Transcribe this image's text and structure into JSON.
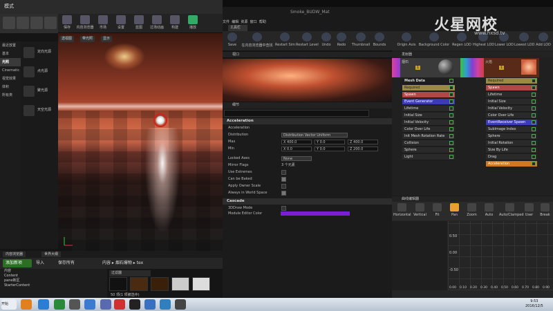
{
  "left_window": {
    "title": "模式",
    "toolbar": [
      "保存",
      "内容浏览器",
      "市场",
      "设置",
      "蓝图",
      "过场动画",
      "构建",
      "播放"
    ],
    "place_categories": [
      "最近放置",
      "基本",
      "光照",
      "Cinematic",
      "视觉效果",
      "体积",
      "所有类"
    ],
    "place_items": [
      "定向光源",
      "点光源",
      "聚光源",
      "天空光源"
    ],
    "viewport_buttons": [
      "透视图",
      "带光照",
      "显示"
    ]
  },
  "content_browser": {
    "tabs": [
      "内容浏览器",
      "世界大纲"
    ],
    "add_new": "添加新项",
    "import": "导入",
    "save_all": "保存所有",
    "breadcrumb": [
      "内容",
      "烟石爆物",
      "tex"
    ],
    "tree": [
      "内容",
      "Content",
      "pane新区",
      "StarterContent"
    ],
    "filters": "过滤器",
    "count": "50 项(1 项被选中)"
  },
  "cascade": {
    "window_title": "Smoke_BUDW_Mat",
    "tab": "工具栏",
    "menu": [
      "文件",
      "编辑",
      "资源",
      "窗口",
      "帮助"
    ],
    "toolbar": [
      "Save",
      "在内容浏览器中查找",
      "Restart Sim",
      "Restart Level",
      "Undo",
      "Redo",
      "Thumbnail",
      "Bounds",
      "Origin Axis",
      "Background Color",
      "Regen LOD",
      "Highest LOD",
      "Lower LOD",
      "Lowest LOD",
      "Add LOD"
    ],
    "preview_title": "视口",
    "details_title": "细节",
    "emitters_title": "发射器",
    "curve_title": "曲线编辑器"
  },
  "details": {
    "section1": "Acceleration",
    "rows": [
      {
        "label": "Acceleration",
        "value": ""
      },
      {
        "label": "Distribution",
        "value": "Distribution Vector Uniform"
      },
      {
        "label": "Max",
        "x": "400.0",
        "y": "0.0",
        "z": "400.0"
      },
      {
        "label": "Min",
        "x": "0.0",
        "y": "0.0",
        "z": "200.0"
      },
      {
        "label": "Locked Axes",
        "value": "None"
      },
      {
        "label": "Mirror Flags",
        "value": "3 个元素"
      },
      {
        "label": "Use Extremes",
        "value": ""
      },
      {
        "label": "Can be Baked",
        "value": ""
      },
      {
        "label": "Apply Owner Scale",
        "value": ""
      },
      {
        "label": "Always in World Space",
        "value": ""
      }
    ],
    "section2": "Cascade",
    "rows2": [
      {
        "label": "3DDraw Mode",
        "value": ""
      },
      {
        "label": "Module Editor Color",
        "value": ""
      }
    ]
  },
  "emitters": {
    "emitter1": {
      "name": "烟石",
      "count": "1"
    },
    "emitter2": {
      "name": "火焰",
      "count": "1"
    },
    "col1": [
      "Mesh Data",
      "Required",
      "Spawn",
      "Event Generator",
      "Lifetime",
      "Initial Size",
      "Initial Velocity",
      "Color Over Life",
      "Init Mesh Rotation Rate",
      "Collision",
      "Sphere",
      "Light"
    ],
    "col2": [
      "Required",
      "Spawn",
      "Lifetime",
      "Initial Size",
      "Initial Velocity",
      "Color Over Life",
      "EventReceiver Spawn",
      "SubImage Index",
      "Sphere",
      "Initial Rotation",
      "Size By Life",
      "Drag",
      "Acceleration"
    ]
  },
  "curve": {
    "tools": [
      "Horizontal",
      "Vertical",
      "Fit",
      "Pan",
      "Zoom",
      "Auto",
      "Auto/Clamped",
      "User",
      "Break"
    ],
    "y_labels": [
      "0.50",
      "0.00",
      "-0.50"
    ],
    "x_labels": [
      "0.00",
      "0.10",
      "0.20",
      "0.30",
      "0.40",
      "0.50",
      "0.60",
      "0.70",
      "0.80",
      "0.90"
    ]
  },
  "watermark": {
    "logo": "火星网校",
    "sub": "www.hxsd.tv"
  },
  "taskbar": {
    "start": "开始",
    "time": "9:53",
    "date": "2016/12/5"
  },
  "colors": {
    "module_color": "#7b1fd4",
    "event": "#3b3bb5",
    "spawn": "#b04848",
    "required": "#9b8a45",
    "accel": "#d07a20"
  }
}
